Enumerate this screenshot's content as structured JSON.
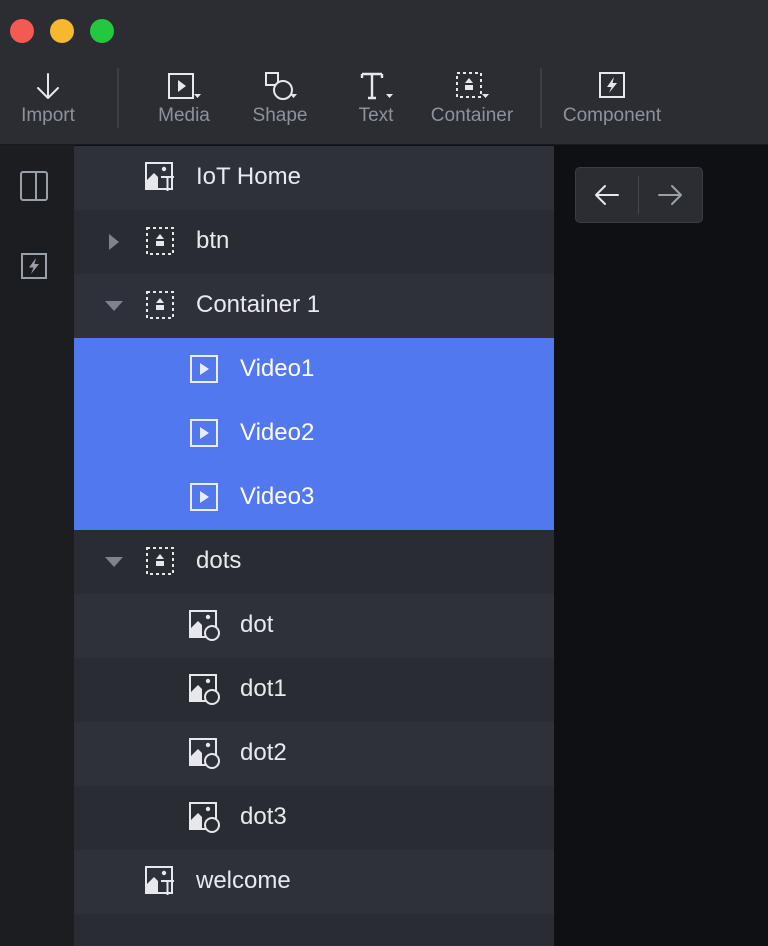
{
  "toolbar": {
    "import": "Import",
    "media": "Media",
    "shape": "Shape",
    "text": "Text",
    "container": "Container",
    "component": "Component"
  },
  "tree": {
    "rows": [
      {
        "label": "IoT Home",
        "type": "text-image"
      },
      {
        "label": "btn",
        "type": "container",
        "expanded": false
      },
      {
        "label": "Container 1",
        "type": "container",
        "expanded": true
      },
      {
        "label": "Video1",
        "type": "media",
        "selected": true
      },
      {
        "label": "Video2",
        "type": "media",
        "selected": true
      },
      {
        "label": "Video3",
        "type": "media",
        "selected": true
      },
      {
        "label": "dots",
        "type": "container",
        "expanded": true
      },
      {
        "label": "dot",
        "type": "shape-image"
      },
      {
        "label": "dot1",
        "type": "shape-image"
      },
      {
        "label": "dot2",
        "type": "shape-image"
      },
      {
        "label": "dot3",
        "type": "shape-image"
      },
      {
        "label": "welcome",
        "type": "text-image"
      }
    ]
  },
  "colors": {
    "selection": "#5278f0",
    "toolbar": "#2b2d33",
    "close": "#f45952",
    "minimize": "#f6b731",
    "maximize": "#23c840"
  }
}
